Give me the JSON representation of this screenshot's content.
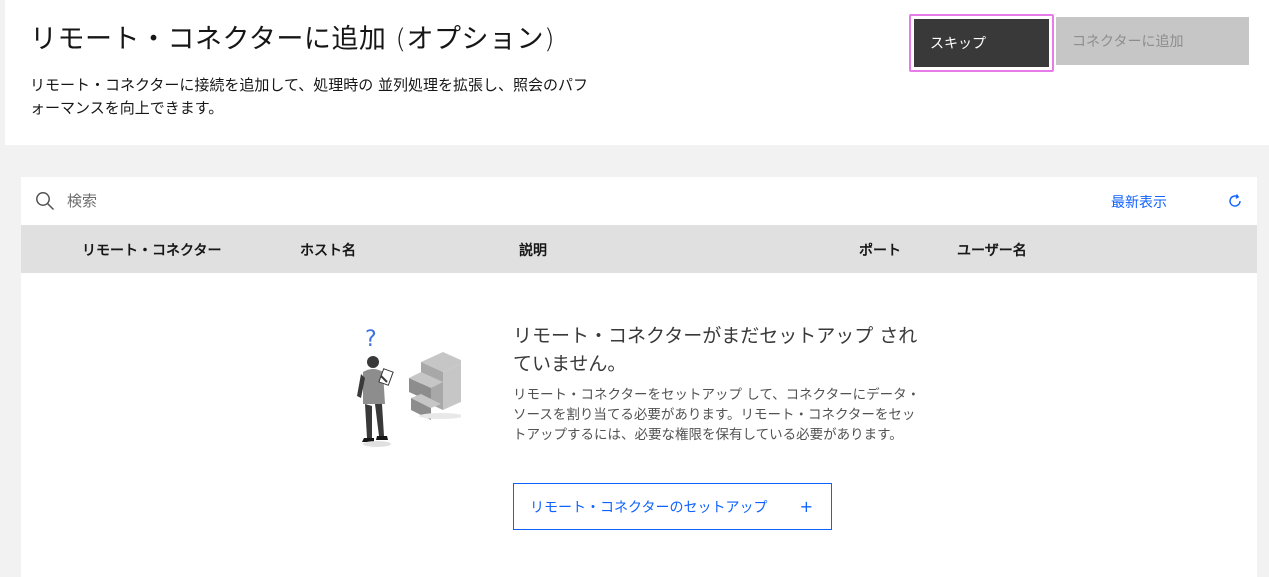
{
  "header": {
    "title": "リモート・コネクターに追加 (オプション)",
    "description": "リモート・コネクターに接続を追加して、処理時の 並列処理を拡張し、照会のパフォーマンスを向上できます。",
    "skip_label": "スキップ",
    "add_label": "コネクターに追加"
  },
  "toolbar": {
    "search_placeholder": "検索",
    "refresh_label": "最新表示"
  },
  "table": {
    "columns": [
      "リモート・コネクター",
      "ホスト名",
      "説明",
      "ポート",
      "ユーザー名"
    ]
  },
  "empty_state": {
    "title": "リモート・コネクターがまだセットアップ されていません。",
    "body": "リモート・コネクターをセットアップ して、コネクターにデータ・ソースを割り当てる必要があります。リモート・コネクターをセットアップするには、必要な権限を保有している必要があります。",
    "setup_button_label": "リモート・コネクターのセットアップ",
    "setup_button_icon": "+"
  },
  "colors": {
    "accent": "#0f62fe",
    "primary_button": "#393939",
    "disabled_button": "#c6c6c6",
    "focus_outline": "#e77ce9"
  }
}
